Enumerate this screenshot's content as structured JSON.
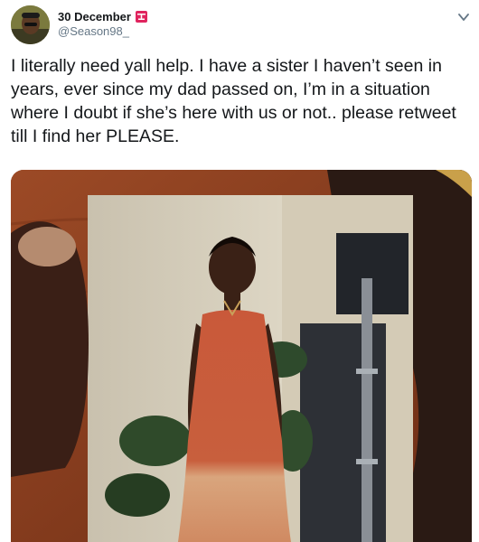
{
  "tweet": {
    "display_name": "30 December",
    "handle": "@Season98_",
    "text": "I literally need yall help. I have a sister I haven’t seen in years, ever since my dad passed on, I’m in a situation where I doubt if she’s here with us or not.. please retweet till I find her PLEASE.",
    "name_badge_icon": "flag-emoji-icon",
    "menu_icon": "chevron-down-icon"
  },
  "colors": {
    "text_primary": "#14171a",
    "text_secondary": "#657786",
    "badge_red": "#e0245e"
  }
}
